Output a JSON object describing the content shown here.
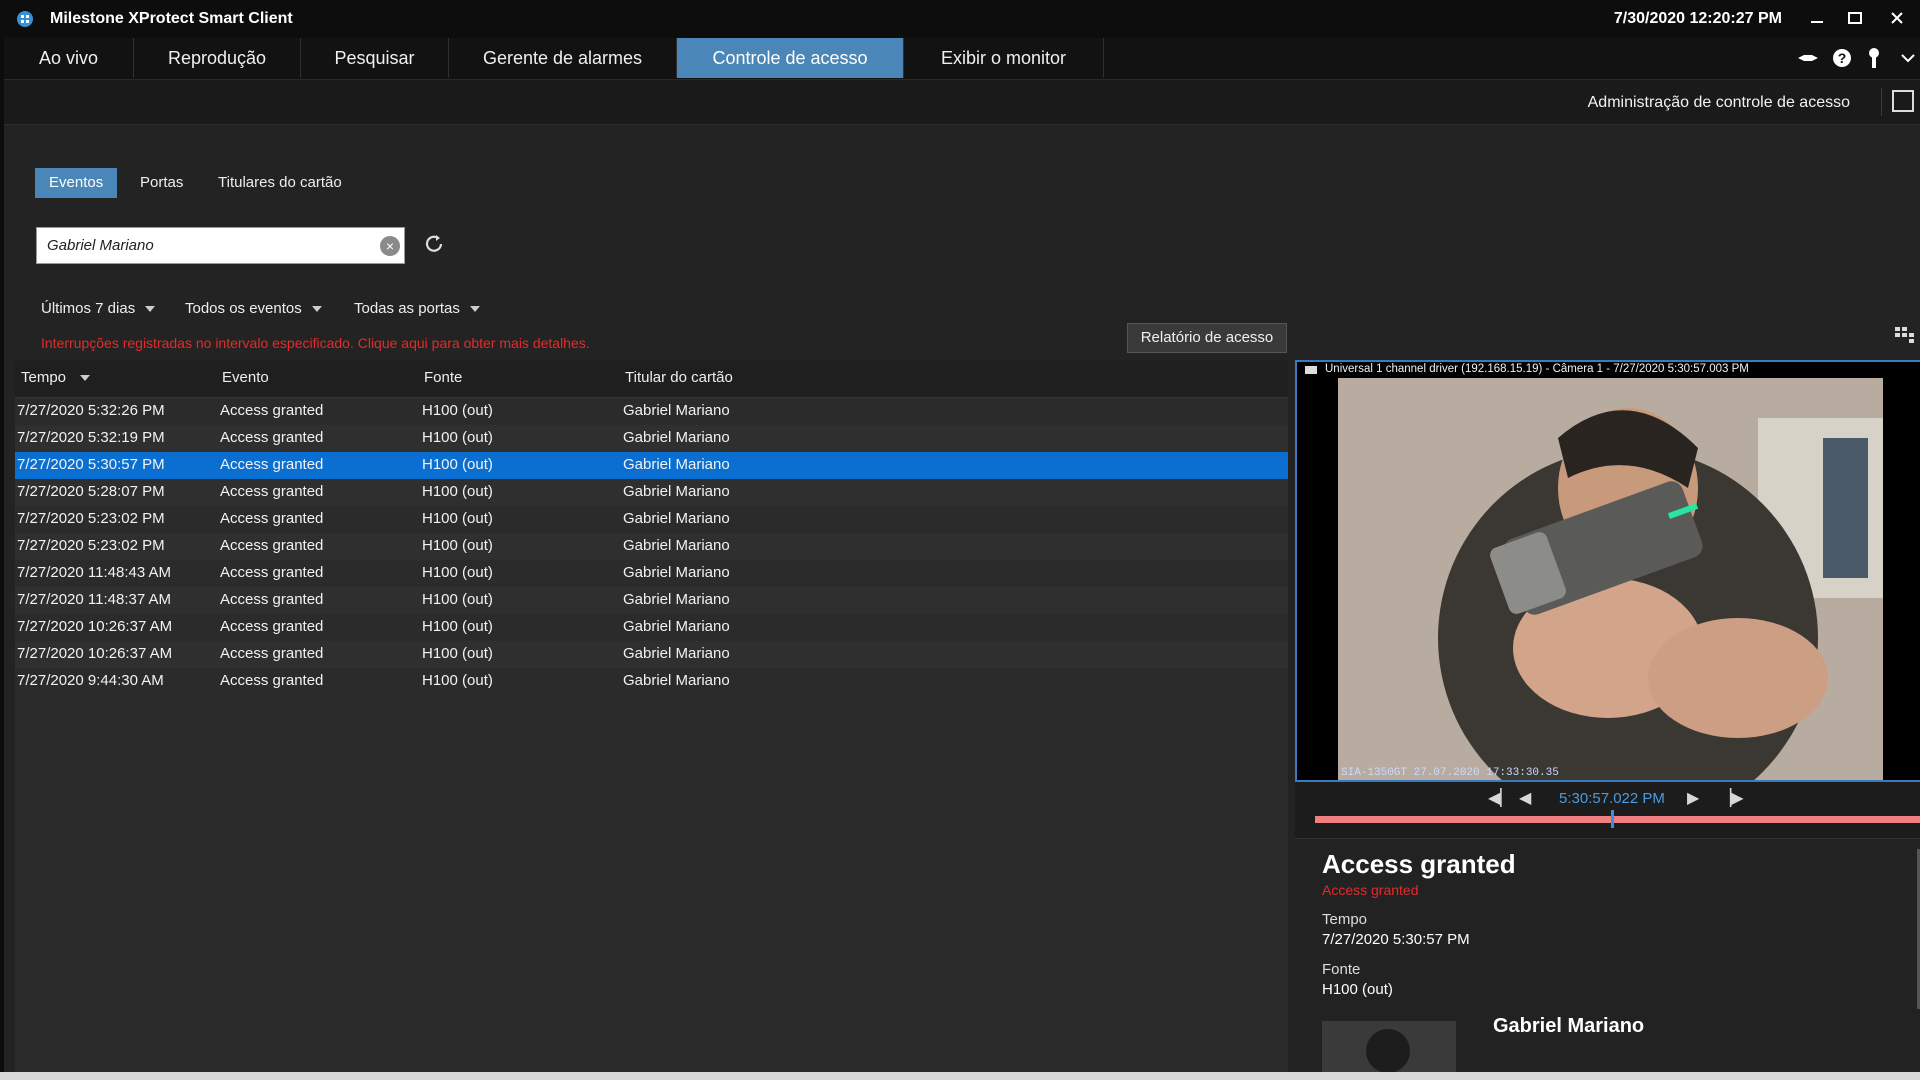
{
  "window": {
    "title": "Milestone XProtect Smart Client",
    "clock": "7/30/2020 12:20:27 PM"
  },
  "tabs": [
    {
      "label": "Ao vivo"
    },
    {
      "label": "Reprodução"
    },
    {
      "label": "Pesquisar"
    },
    {
      "label": "Gerente de alarmes"
    },
    {
      "label": "Controle de acesso",
      "active": true
    },
    {
      "label": "Exibir o monitor"
    }
  ],
  "toolbar_icons": [
    "network-icon",
    "help-icon",
    "key-icon",
    "chevron-down-icon"
  ],
  "admin": {
    "label": "Administração de controle de acesso"
  },
  "subtabs": [
    {
      "label": "Eventos",
      "active": true
    },
    {
      "label": "Portas"
    },
    {
      "label": "Titulares do cartão"
    }
  ],
  "search": {
    "value": "Gabriel Mariano"
  },
  "filters": {
    "period": "Últimos 7 dias",
    "events": "Todos os eventos",
    "doors": "Todas as portas"
  },
  "warning": "Interrupções registradas no intervalo especificado. Clique aqui para obter mais detalhes.",
  "report_button": "Relatório de acesso",
  "table": {
    "columns": [
      "Tempo",
      "Evento",
      "Fonte",
      "Titular do cartão"
    ],
    "rows": [
      {
        "time": "7/27/2020 5:32:26 PM",
        "event": "Access granted",
        "source": "H100 (out)",
        "holder": "Gabriel Mariano"
      },
      {
        "time": "7/27/2020 5:32:19 PM",
        "event": "Access granted",
        "source": "H100 (out)",
        "holder": "Gabriel Mariano"
      },
      {
        "time": "7/27/2020 5:30:57 PM",
        "event": "Access granted",
        "source": "H100 (out)",
        "holder": "Gabriel Mariano",
        "selected": true
      },
      {
        "time": "7/27/2020 5:28:07 PM",
        "event": "Access granted",
        "source": "H100 (out)",
        "holder": "Gabriel Mariano"
      },
      {
        "time": "7/27/2020 5:23:02 PM",
        "event": "Access granted",
        "source": "H100 (out)",
        "holder": "Gabriel Mariano"
      },
      {
        "time": "7/27/2020 5:23:02 PM",
        "event": "Access granted",
        "source": "H100 (out)",
        "holder": "Gabriel Mariano"
      },
      {
        "time": "7/27/2020 11:48:43 AM",
        "event": "Access granted",
        "source": "H100 (out)",
        "holder": "Gabriel Mariano"
      },
      {
        "time": "7/27/2020 11:48:37 AM",
        "event": "Access granted",
        "source": "H100 (out)",
        "holder": "Gabriel Mariano"
      },
      {
        "time": "7/27/2020 10:26:37 AM",
        "event": "Access granted",
        "source": "H100 (out)",
        "holder": "Gabriel Mariano"
      },
      {
        "time": "7/27/2020 10:26:37 AM",
        "event": "Access granted",
        "source": "H100 (out)",
        "holder": "Gabriel Mariano"
      },
      {
        "time": "7/27/2020 9:44:30 AM",
        "event": "Access granted",
        "source": "H100 (out)",
        "holder": "Gabriel Mariano"
      }
    ]
  },
  "video": {
    "caption": "Universal 1 channel driver (192.168.15.19) - Câmera 1 - 7/27/2020 5:30:57.003 PM",
    "overlay": "SIA-1350GT 27.07.2020 17:33:30.35",
    "playback_time": "5:30:57.022 PM"
  },
  "details": {
    "title": "Access granted",
    "subtitle": "Access granted",
    "time_label": "Tempo",
    "time_value": "7/27/2020 5:30:57 PM",
    "source_label": "Fonte",
    "source_value": "H100 (out)",
    "holder_name": "Gabriel Mariano"
  },
  "colors": {
    "accent": "#4a87b8",
    "selection": "#0a6fd1",
    "warning": "#e32b2b",
    "timeline": "#f07f7f",
    "background": "#232323"
  }
}
